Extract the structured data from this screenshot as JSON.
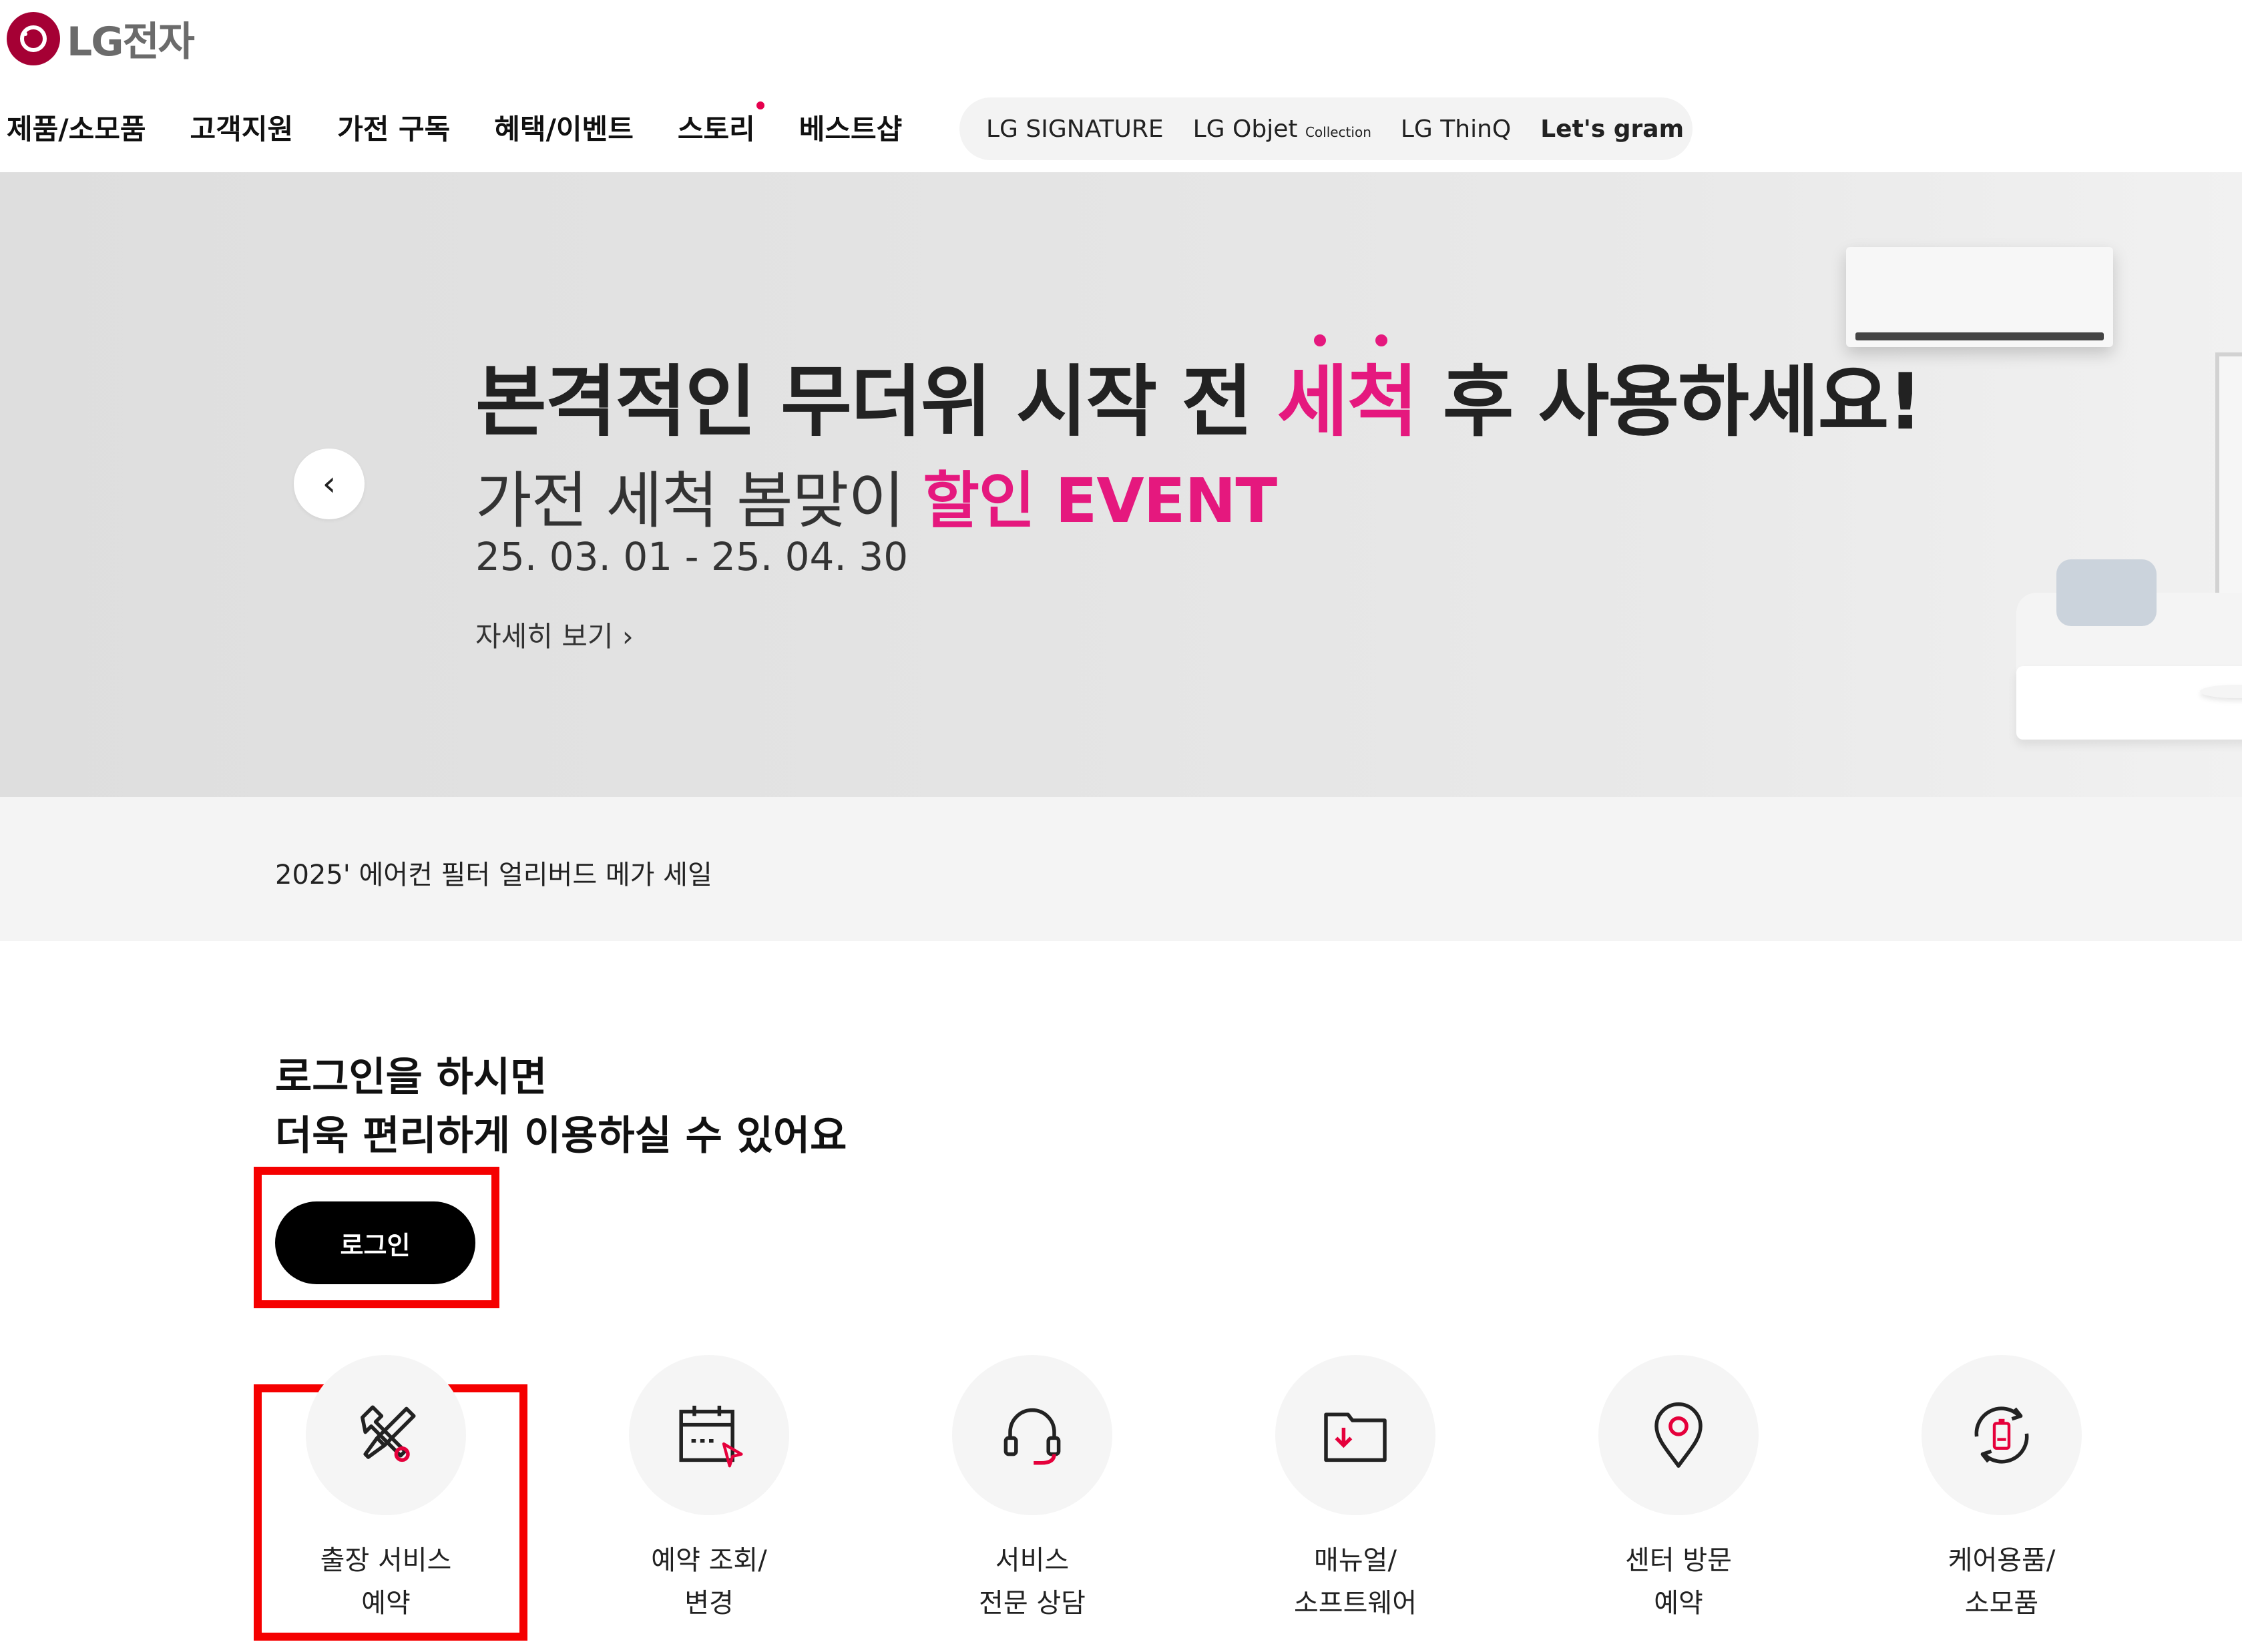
{
  "header": {
    "logo_text": "LG전자",
    "nav": [
      "제품/소모품",
      "고객지원",
      "가전 구독",
      "혜택/이벤트",
      "스토리",
      "베스트샵"
    ],
    "brands": {
      "signature": "LG SIGNATURE",
      "objet": "LG Objet",
      "objet_sub": "Collection",
      "thinq": "LG ThinQ",
      "gram": "Let's gram"
    }
  },
  "hero": {
    "title_pre": "본격적인 무더위 시작 전 ",
    "title_accent": "세척",
    "title_post": " 후 사용하세요!",
    "sub_pre": "가전 세척 봄맞이 ",
    "sub_accent": "할인 EVENT",
    "date": "25. 03. 01 - 25. 04. 30",
    "more": "자세히 보기 ›",
    "prev_arrow": "‹"
  },
  "promo": {
    "text": "2025' 에어컨 필터 얼리버드 메가 세일"
  },
  "login": {
    "heading_line1": "로그인을 하시면",
    "heading_line2": "더욱 편리하게 이용하실 수 있어요",
    "button": "로그인"
  },
  "services": [
    {
      "icon": "tools-icon",
      "line1": "출장 서비스",
      "line2": "예약"
    },
    {
      "icon": "calendar-icon",
      "line1": "예약 조회/",
      "line2": "변경"
    },
    {
      "icon": "headset-icon",
      "line1": "서비스",
      "line2": "전문 상담"
    },
    {
      "icon": "folder-download-icon",
      "line1": "매뉴얼/",
      "line2": "소프트웨어"
    },
    {
      "icon": "location-pin-icon",
      "line1": "센터 방문",
      "line2": "예약"
    },
    {
      "icon": "refresh-battery-icon",
      "line1": "케어용품/",
      "line2": "소모품"
    }
  ],
  "colors": {
    "brand_red": "#a50034",
    "accent_pink": "#e5187e",
    "highlight_red": "#f50000",
    "icon_red": "#e5003b"
  }
}
